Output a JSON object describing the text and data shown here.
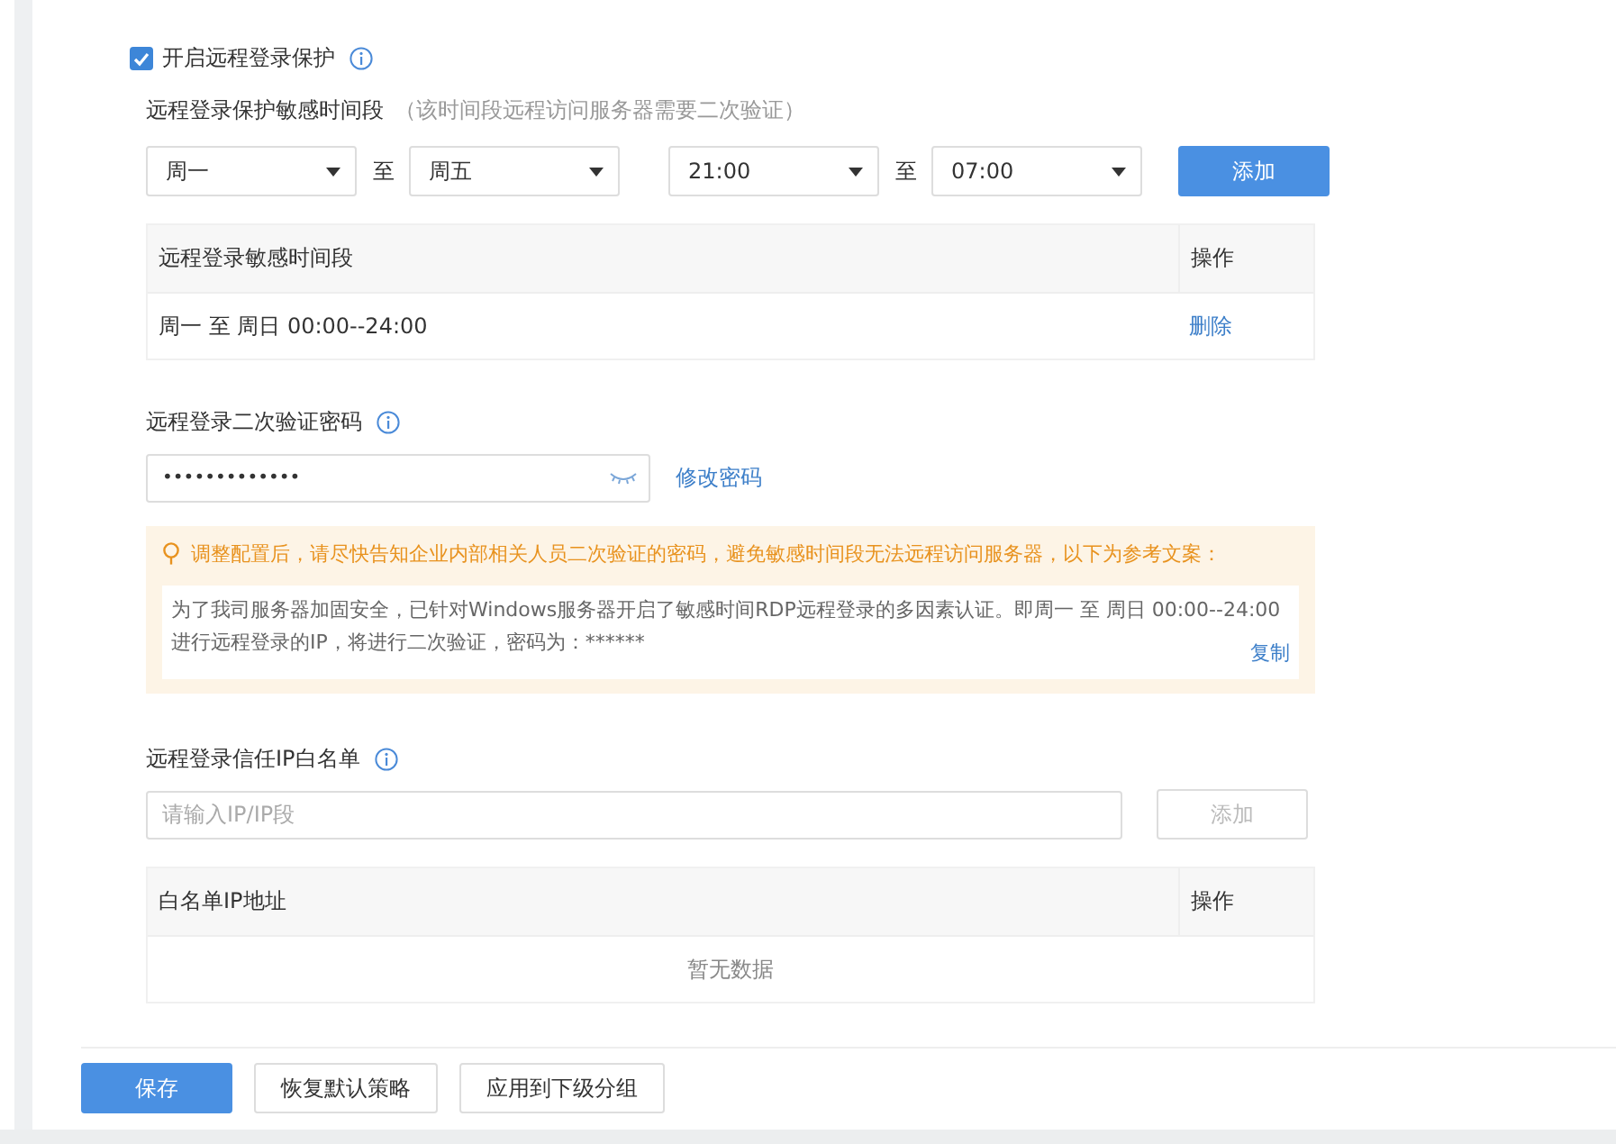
{
  "protection": {
    "label": "开启远程登录保护",
    "checked": true
  },
  "period": {
    "label": "远程登录保护敏感时间段",
    "hint": "（该时间段远程访问服务器需要二次验证）",
    "from_day": "周一",
    "to_day": "周五",
    "from_time": "21:00",
    "to_time": "07:00",
    "separators": [
      "至",
      "至"
    ],
    "add_button": {
      "label": "添加",
      "disabled": false
    },
    "table": {
      "columns": [
        "远程登录敏感时间段",
        "操作"
      ],
      "rows": [
        {
          "range": "周一 至 周日 00:00--24:00",
          "action": "删除"
        }
      ]
    }
  },
  "password": {
    "label": "远程登录二次验证密码",
    "value": "•••••••••••••",
    "change_link": "修改密码"
  },
  "notice": {
    "message": "调整配置后，请尽快告知企业内部相关人员二次验证的密码，避免敏感时间段无法远程访问服务器，以下为参考文案：",
    "template_lines": [
      "为了我司服务器加固安全，已针对Windows服务器开启了敏感时间RDP远程登录的多因素认证。即周一 至 周日 00:00--24:00",
      "进行远程登录的IP，将进行二次验证，密码为：******"
    ],
    "copy_link": "复制"
  },
  "whitelist": {
    "label": "远程登录信任IP白名单",
    "placeholder": "请输入IP/IP段",
    "add_button": {
      "label": "添加",
      "disabled": true
    },
    "table": {
      "columns": [
        "白名单IP地址",
        "操作"
      ],
      "empty_text": "暂无数据"
    }
  },
  "footer_buttons": [
    {
      "label": "保存",
      "kind": "primary"
    },
    {
      "label": "恢复默认策略",
      "kind": "default"
    },
    {
      "label": "应用到下级分组",
      "kind": "default"
    }
  ]
}
